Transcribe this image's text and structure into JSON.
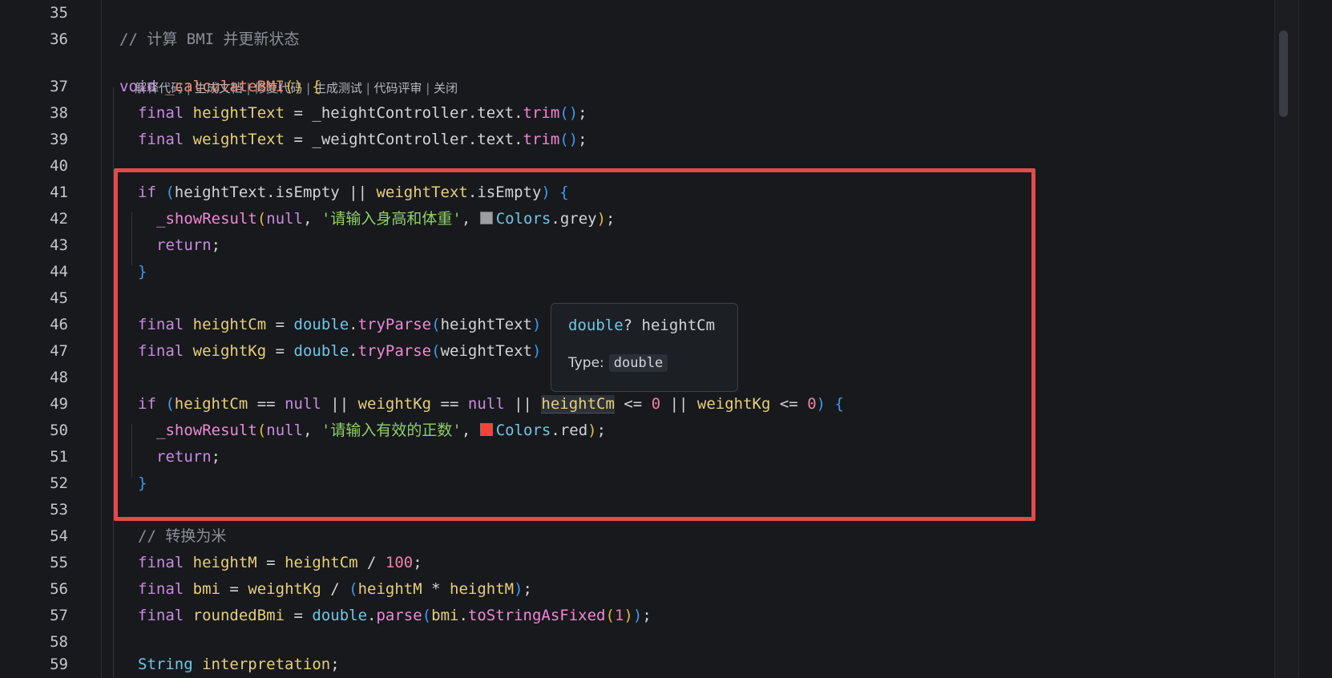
{
  "editor": {
    "line_numbers": [
      "35",
      "36",
      "37",
      "38",
      "39",
      "40",
      "41",
      "42",
      "43",
      "44",
      "45",
      "46",
      "47",
      "48",
      "49",
      "50",
      "51",
      "52",
      "53",
      "54",
      "55",
      "56",
      "57",
      "58",
      "59"
    ],
    "codelens": [
      "解释代码",
      "生成文档",
      "修复代码",
      "生成测试",
      "代码评审",
      "关闭"
    ],
    "codelens_separator": " | "
  },
  "code": {
    "l36": "// 计算 BMI 并更新状态",
    "l37": [
      "void",
      "_calculateBMI",
      "()",
      " {"
    ],
    "l38": [
      "final",
      "heightText",
      " = ",
      "_heightController",
      ".",
      "text",
      ".",
      "trim",
      "()",
      ";"
    ],
    "l39": [
      "final",
      "weightText",
      " = ",
      "_weightController",
      ".",
      "text",
      ".",
      "trim",
      "()",
      ";"
    ],
    "l41": [
      "if",
      " (",
      "heightText",
      ".",
      "isEmpty",
      " || ",
      "weightText",
      ".",
      "isEmpty",
      ")",
      " {"
    ],
    "l42": [
      "_showResult",
      "(",
      "null",
      ", ",
      "'请输入身高和体重'",
      ", ",
      "Colors",
      ".",
      "grey",
      ")",
      ";"
    ],
    "l43": [
      "return",
      ";"
    ],
    "l44": "}",
    "l46": [
      "final",
      "heightCm",
      " = ",
      "double",
      ".",
      "tryParse",
      "(",
      "heightText",
      ")"
    ],
    "l47": [
      "final",
      "weightKg",
      " = ",
      "double",
      ".",
      "tryParse",
      "(",
      "weightText",
      ")"
    ],
    "l49": [
      "if",
      " (",
      "heightCm",
      " == ",
      "null",
      " || ",
      "weightKg",
      " == ",
      "null",
      " || ",
      "heightCm",
      " <= ",
      "0",
      " || ",
      "weightKg",
      " <= ",
      "0",
      ")",
      " {"
    ],
    "l50": [
      "_showResult",
      "(",
      "null",
      ", ",
      "'请输入有效的正数'",
      ", ",
      "Colors",
      ".",
      "red",
      ")",
      ";"
    ],
    "l51": [
      "return",
      ";"
    ],
    "l52": "}",
    "l54": "// 转换为米",
    "l55": [
      "final",
      "heightM",
      " = ",
      "heightCm",
      " / ",
      "100",
      ";"
    ],
    "l56": [
      "final",
      "bmi",
      " = ",
      "weightKg",
      " / ",
      "(",
      "heightM",
      " * ",
      "heightM",
      ")",
      ";"
    ],
    "l57": [
      "final",
      "roundedBmi",
      " = ",
      "double",
      ".",
      "parse",
      "(",
      "bmi",
      ".",
      "toStringAsFixed",
      "(",
      "1",
      ")",
      ")",
      ";"
    ],
    "l59": [
      "String",
      "interpretation",
      ";"
    ]
  },
  "tooltip": {
    "sig_type": "double",
    "sig_rest": "? heightCm",
    "type_label": "Type:",
    "type_value": "double"
  },
  "colors": {
    "highlight_box": "#e8484c",
    "swatch_grey": "#9e9e9e",
    "swatch_red": "#f44336"
  }
}
